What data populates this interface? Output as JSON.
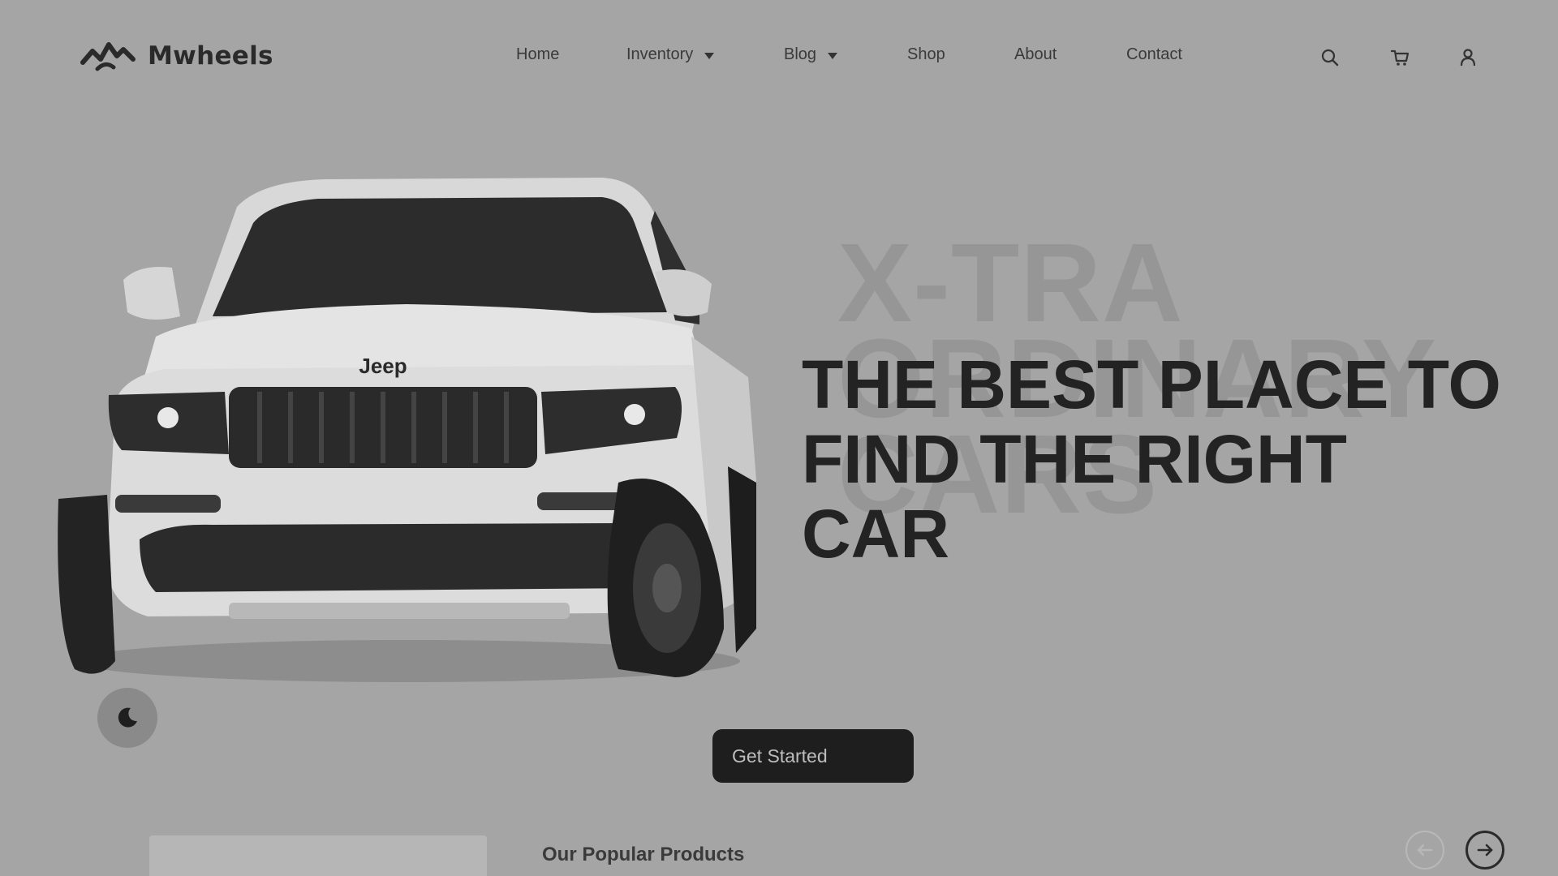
{
  "brand": {
    "name": "Mwheels",
    "logo_icon": "mountain-wave-logo"
  },
  "nav": {
    "items": [
      {
        "label": "Home",
        "has_dropdown": false
      },
      {
        "label": "Inventory",
        "has_dropdown": true
      },
      {
        "label": "Blog",
        "has_dropdown": true
      },
      {
        "label": "Shop",
        "has_dropdown": false
      },
      {
        "label": "About",
        "has_dropdown": false
      },
      {
        "label": "Contact",
        "has_dropdown": false
      }
    ]
  },
  "header_icons": [
    "search-icon",
    "cart-icon",
    "user-icon"
  ],
  "hero": {
    "background_text": [
      "X-TRA",
      "ORDINARY",
      "CARS"
    ],
    "title_lines": [
      "THE BEST PLACE TO",
      "FIND THE RIGHT",
      "CAR"
    ],
    "car_badge": "Jeep",
    "cta_label": "Get Started"
  },
  "theme_toggle_icon": "moon-icon",
  "products": {
    "section_title": "Our Popular Products",
    "prev_icon": "arrow-left-icon",
    "next_icon": "arrow-right-icon"
  },
  "colors": {
    "background": "#a5a5a5",
    "text_dark": "#232323",
    "button": "#1e1e1e"
  }
}
